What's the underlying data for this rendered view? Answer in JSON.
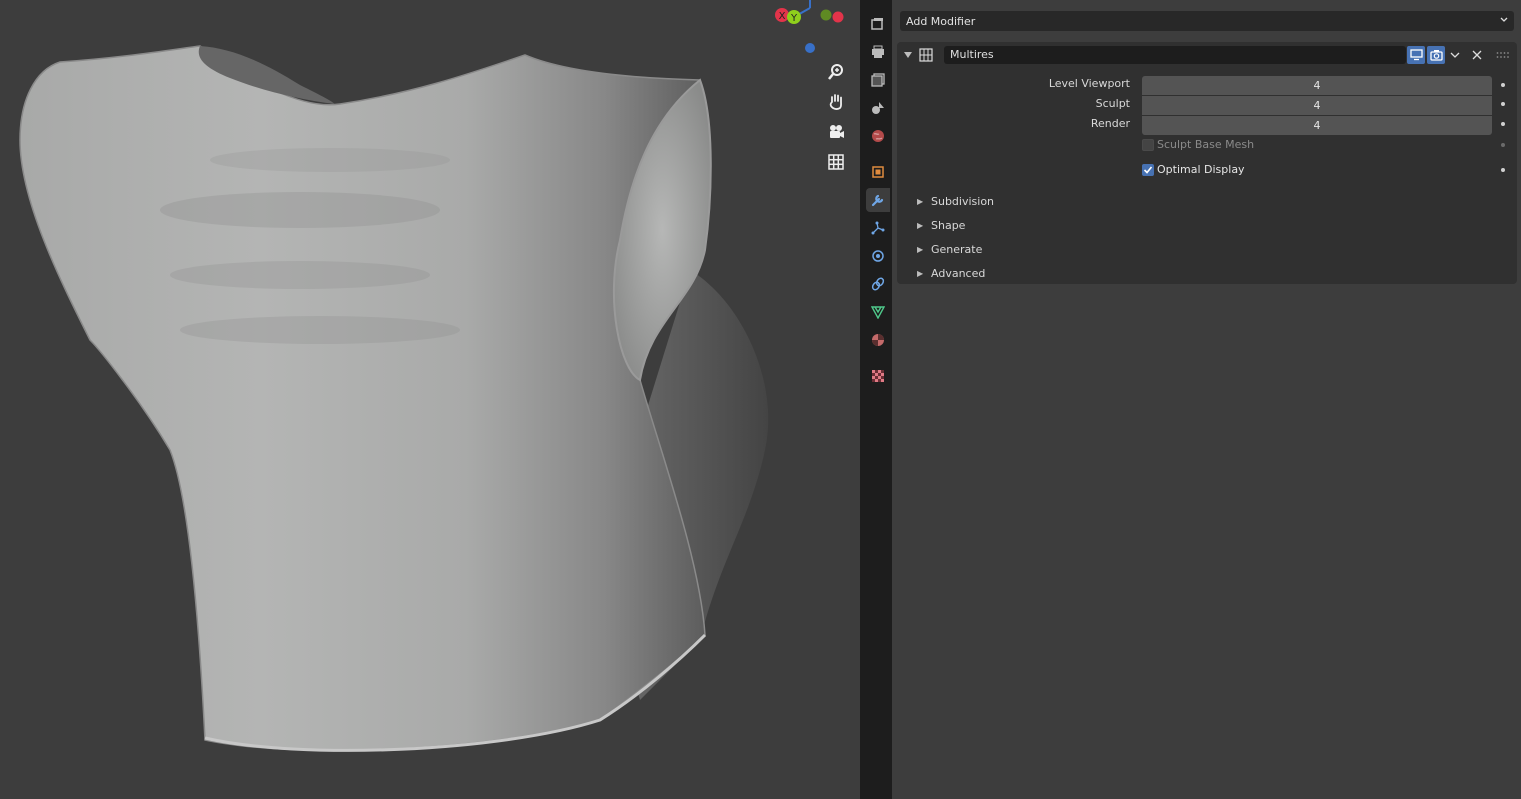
{
  "modifier_stack": {
    "add_modifier_label": "Add Modifier",
    "modifier": {
      "name": "Multires",
      "properties": [
        {
          "label": "Level Viewport",
          "value": "4"
        },
        {
          "label": "Sculpt",
          "value": "4"
        },
        {
          "label": "Render",
          "value": "4"
        }
      ],
      "checkboxes": [
        {
          "label": "Sculpt Base Mesh",
          "checked": false,
          "enabled": false
        },
        {
          "label": "Optimal Display",
          "checked": true,
          "enabled": true
        }
      ],
      "subpanels": [
        "Subdivision",
        "Shape",
        "Generate",
        "Advanced"
      ]
    }
  },
  "gizmo": {
    "y_label": "Y",
    "x_label": "X"
  },
  "colors": {
    "accent": "#4772b3",
    "panel_bg": "#303030",
    "editor_bg": "#3d3d3d",
    "axis_x": "#e2344a",
    "axis_y": "#8fcf1c",
    "axis_z": "#3870c8"
  },
  "tabs": [
    "tool-icon",
    "render-icon",
    "output-icon",
    "view-layer-icon",
    "scene-icon",
    "world-icon",
    "object-icon",
    "modifier-icon",
    "particles-icon",
    "physics-icon",
    "constraints-icon",
    "data-icon",
    "material-icon",
    "texture-icon"
  ]
}
